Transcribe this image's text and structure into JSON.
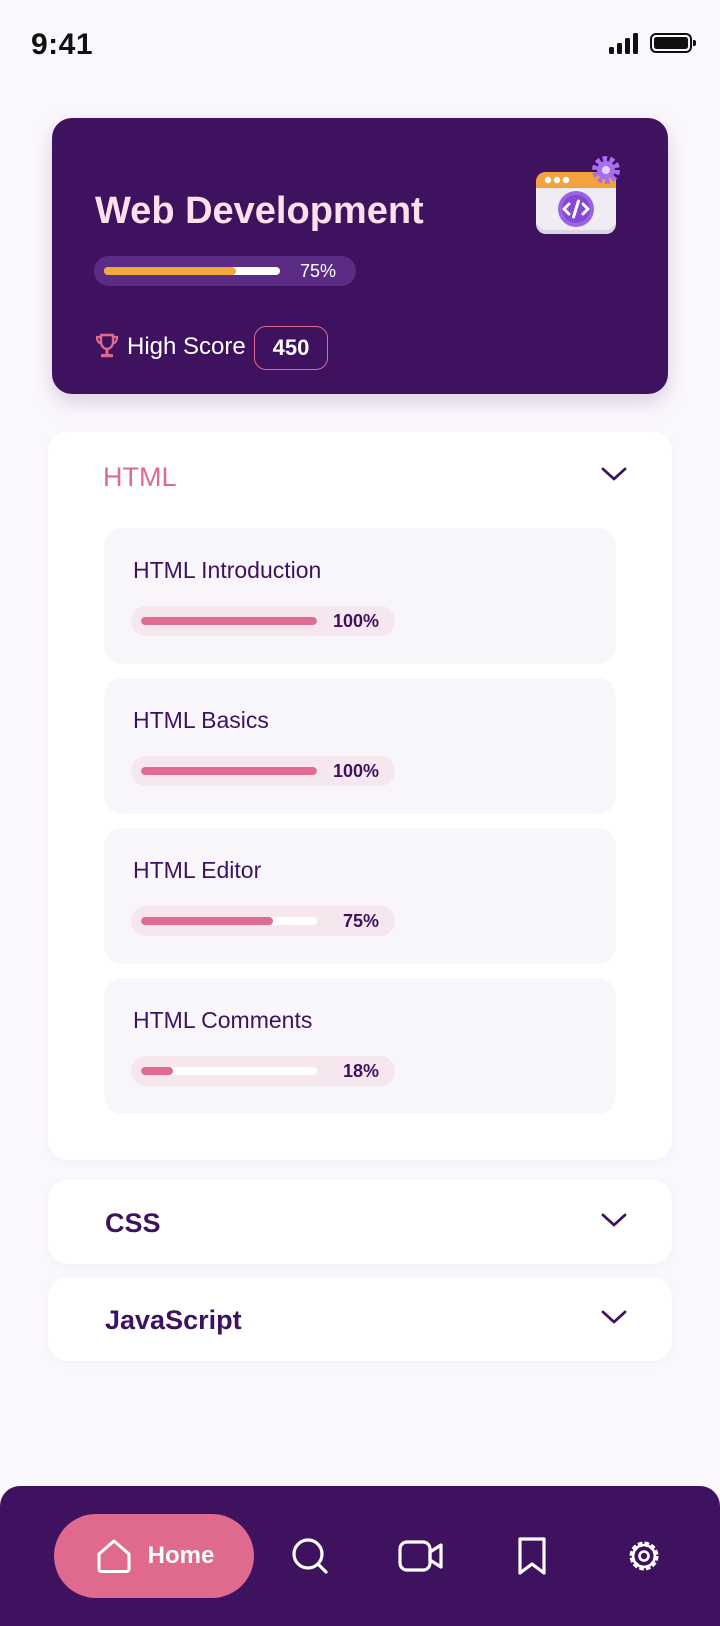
{
  "status_bar": {
    "time": "9:41"
  },
  "course": {
    "title": "Web Development",
    "progress": 0.75,
    "progress_label": "75%",
    "high_score_label": "High Score",
    "high_score": "450",
    "icon": "web-code-gear-icon"
  },
  "sections": [
    {
      "title": "HTML",
      "expanded": true,
      "lessons": [
        {
          "title": "HTML Introduction",
          "progress": 1.0,
          "progress_label": "100%"
        },
        {
          "title": "HTML Basics",
          "progress": 1.0,
          "progress_label": "100%"
        },
        {
          "title": "HTML Editor",
          "progress": 0.75,
          "progress_label": "75%"
        },
        {
          "title": "HTML Comments",
          "progress": 0.18,
          "progress_label": "18%"
        }
      ]
    },
    {
      "title": "CSS",
      "expanded": false
    },
    {
      "title": "JavaScript",
      "expanded": false
    }
  ],
  "nav": {
    "home_label": "Home",
    "items": [
      "home-icon",
      "search-icon",
      "video-icon",
      "bookmark-icon",
      "settings-icon"
    ]
  },
  "colors": {
    "primary": "#3e125e",
    "accent": "#e06a8e",
    "progress_gold": "#f1a83c",
    "title_pink": "#fde0ea"
  }
}
